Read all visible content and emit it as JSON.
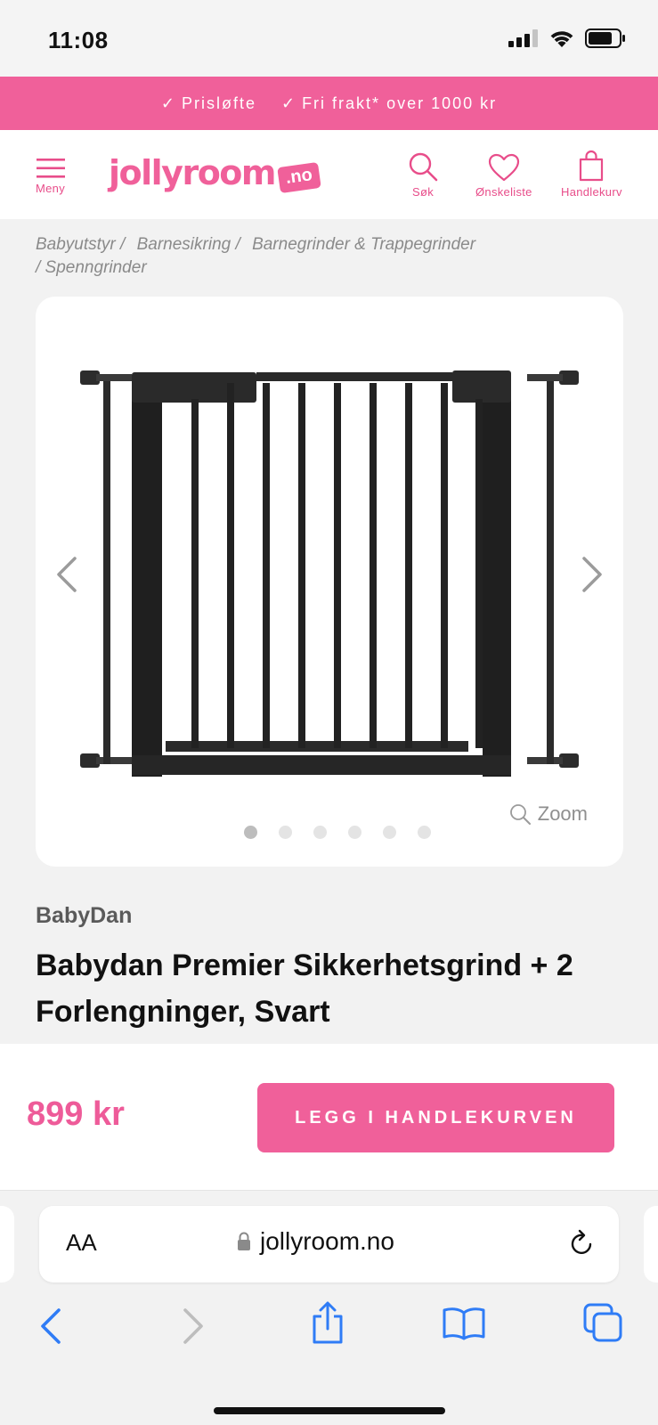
{
  "status": {
    "time": "11:08"
  },
  "promo": {
    "items": [
      "Prisløfte",
      "Fri frakt* over 1000 kr"
    ]
  },
  "header": {
    "menu_label": "Meny",
    "logo_word": "jollyroom",
    "logo_tld": ".no",
    "search_label": "Søk",
    "wishlist_label": "Ønskeliste",
    "cart_label": "Handlekurv"
  },
  "breadcrumb": [
    "Babyutstyr /",
    "Barnesikring /",
    "Barnegrinder & Trappegrinder",
    "/  Spenngrinder"
  ],
  "product": {
    "zoom_label": "Zoom",
    "image_count": 6,
    "active_image": 1,
    "brand": "BabyDan",
    "title": "Babydan Premier Sikkerhetsgrind + 2 Forlengninger, Svart",
    "price": "899 kr",
    "add_to_cart_label": "LEGG I HANDLEKURVEN"
  },
  "browser": {
    "aa_label": "AA",
    "url": "jollyroom.no"
  },
  "colors": {
    "brand_pink": "#f0609a",
    "ios_blue": "#2f7cf6"
  }
}
